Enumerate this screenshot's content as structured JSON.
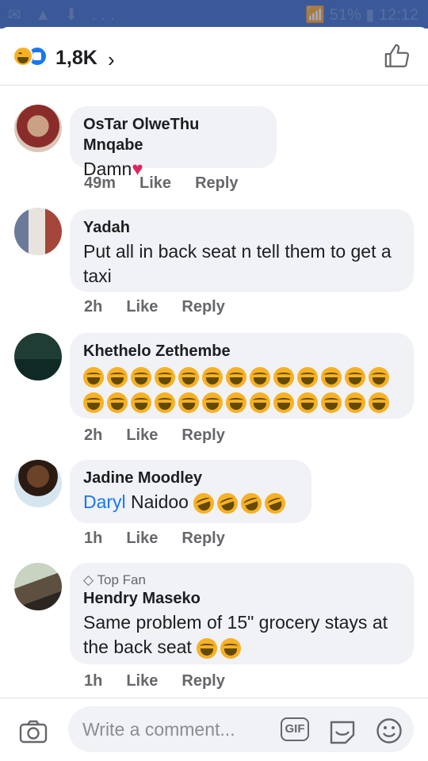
{
  "status_bar": {
    "left": "✉ ▲ ⬇ ...",
    "right": "📶 51% ▮ 12:12"
  },
  "header": {
    "reaction_count": "1,8K",
    "chevron": "›",
    "reactions": [
      "haha-icon",
      "like-icon"
    ]
  },
  "comments": [
    {
      "author": "OsTar OlweThu Mnqabe",
      "text": "Damn",
      "time": "49m",
      "like": "Like",
      "reply": "Reply"
    },
    {
      "author": "Yadah",
      "text": " Put all in back seat n tell them to get a taxi",
      "time": "2h",
      "like": "Like",
      "reply": "Reply"
    },
    {
      "author": "Khethelo Zethembe",
      "text": "",
      "emoji_count": 26,
      "time": "2h",
      "like": "Like",
      "reply": "Reply"
    },
    {
      "author": "Jadine Moodley",
      "mention": "Daryl",
      "text": " Naidoo",
      "emoji_count": 4,
      "time": "1h",
      "like": "Like",
      "reply": "Reply"
    },
    {
      "badge": "Top Fan",
      "author": "Hendry Maseko",
      "text": "Same problem of 15\" grocery stays at the back seat",
      "emoji_count": 2,
      "time": "1h",
      "like": "Like",
      "reply": "Reply"
    }
  ],
  "composer": {
    "placeholder": "Write a comment...",
    "gif_label": "GIF"
  },
  "colors": {
    "accent": "#1877f2",
    "bubble": "#f0f2f5",
    "meta": "#65676b",
    "emoji": "#f7b125"
  }
}
